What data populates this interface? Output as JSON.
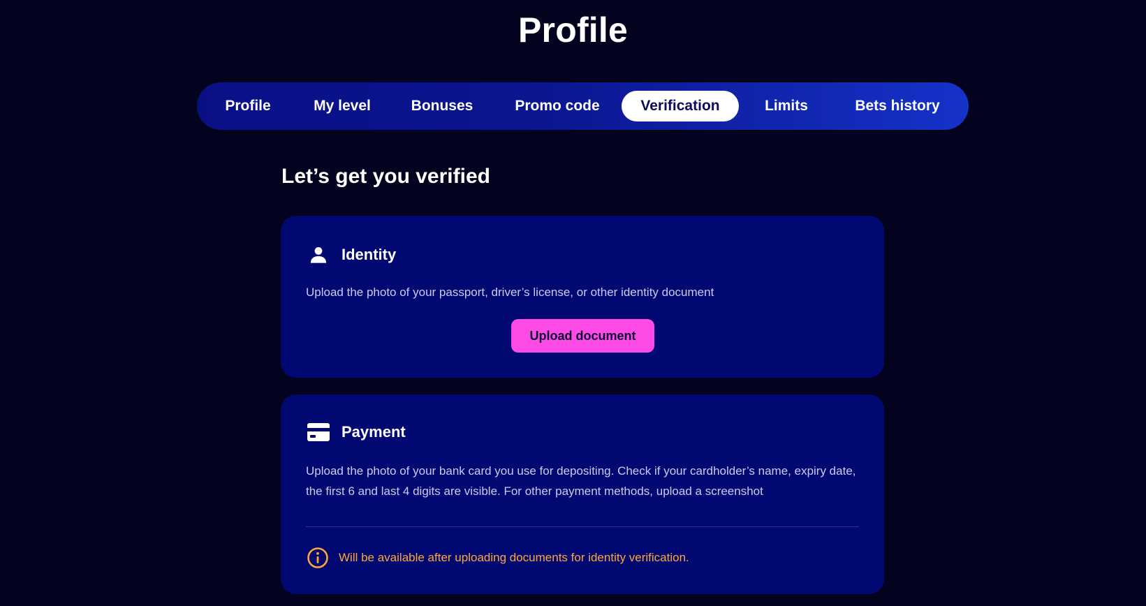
{
  "page": {
    "title": "Profile"
  },
  "tabs": [
    {
      "label": "Profile",
      "active": false
    },
    {
      "label": "My level",
      "active": false
    },
    {
      "label": "Bonuses",
      "active": false
    },
    {
      "label": "Promo code",
      "active": false
    },
    {
      "label": "Verification",
      "active": true
    },
    {
      "label": "Limits",
      "active": false
    },
    {
      "label": "Bets history",
      "active": false
    }
  ],
  "verification": {
    "heading": "Let’s get you verified",
    "identity": {
      "icon": "person-icon",
      "title": "Identity",
      "description": "Upload the photo of your passport, driver’s license, or other identity document",
      "button_label": "Upload document"
    },
    "payment": {
      "icon": "credit-card-icon",
      "title": "Payment",
      "description": "Upload the photo of your bank card you use for depositing. Check if your cardholder’s name, expiry date, the first 6 and last 4 digits are visible. For other payment methods, upload a screenshot",
      "notice_icon": "info-icon",
      "notice": "Will be available after uploading documents for identity verification."
    }
  },
  "colors": {
    "background": "#03021f",
    "card": "#020872",
    "accent_button": "#ff4be6",
    "notice": "#ffa63a",
    "tabbar_start": "#0a0f86",
    "tabbar_end": "#1532c8"
  }
}
